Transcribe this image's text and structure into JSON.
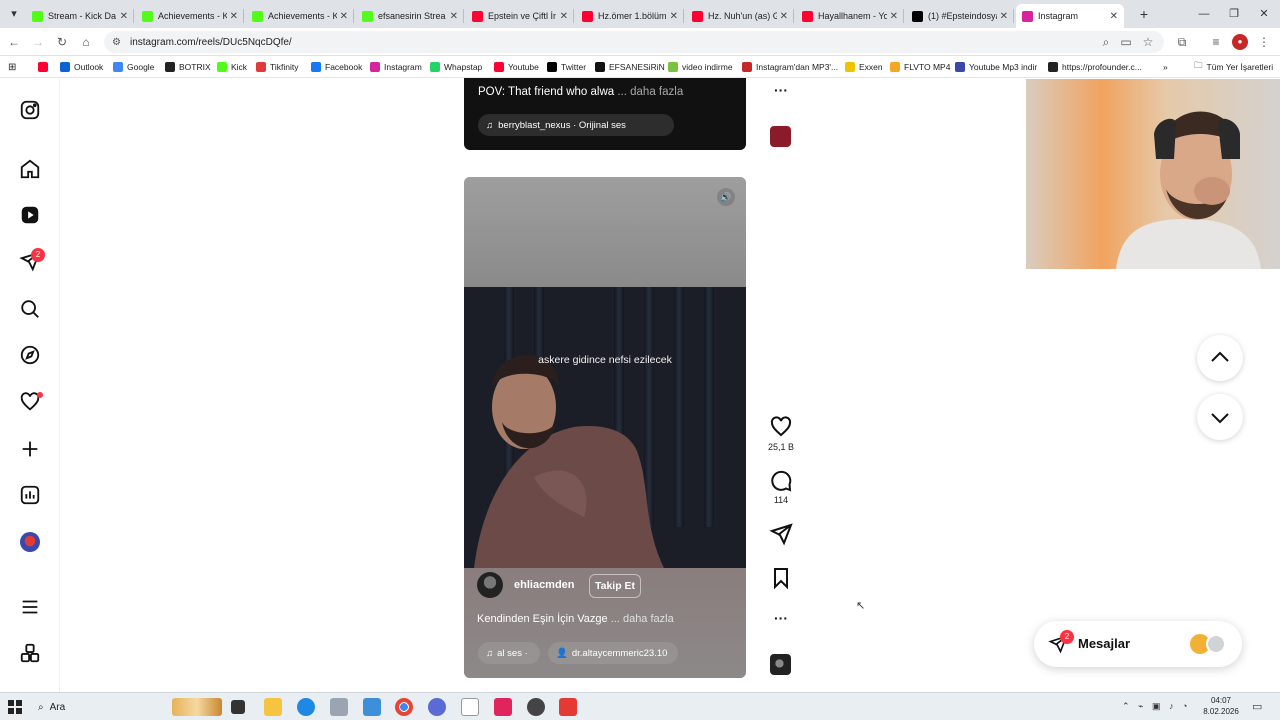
{
  "browser": {
    "tabs": [
      {
        "title": "Stream - Kick Da",
        "favicon_color": "#53fc18",
        "active": false
      },
      {
        "title": "Achievements - K",
        "favicon_color": "#53fc18",
        "active": false
      },
      {
        "title": "Achievements - K",
        "favicon_color": "#53fc18",
        "active": false
      },
      {
        "title": "efsanesirin Strea",
        "favicon_color": "#53fc18",
        "active": false
      },
      {
        "title": "Epstein ve Çiftl İr",
        "favicon_color": "#ff0033",
        "active": false
      },
      {
        "title": "Hz.ömer 1.bölüm",
        "favicon_color": "#ff0033",
        "active": false
      },
      {
        "title": "Hz. Nuh'un (as) G",
        "favicon_color": "#ff0033",
        "active": false
      },
      {
        "title": "Hayallhanem - You",
        "favicon_color": "#ff0033",
        "active": false
      },
      {
        "title": "(1) #Epsteindosya",
        "favicon_color": "#000000",
        "active": false
      },
      {
        "title": "Instagram",
        "favicon_color": "#d6249f",
        "active": true
      }
    ],
    "new_tab": "+",
    "url": "instagram.com/reels/DUc5NqcDQfe/",
    "bookmarks": [
      {
        "label": "",
        "color": "#ff0033"
      },
      {
        "label": "Outlook",
        "color": "#0a64d6"
      },
      {
        "label": "Google",
        "color": "#4285f4"
      },
      {
        "label": "BOTRIX",
        "color": "#222222"
      },
      {
        "label": "Kick",
        "color": "#53fc18"
      },
      {
        "label": "Tikfinity",
        "color": "#e03a3a"
      },
      {
        "label": "Facebook",
        "color": "#1877f2"
      },
      {
        "label": "Instagram",
        "color": "#d6249f"
      },
      {
        "label": "Whapstap",
        "color": "#25d366"
      },
      {
        "label": "Youtube",
        "color": "#ff0033"
      },
      {
        "label": "Twitter",
        "color": "#000000"
      },
      {
        "label": "EFSANESiRiN",
        "color": "#111111"
      },
      {
        "label": "video indirme",
        "color": "#7ac142"
      },
      {
        "label": "Instagram'dan MP3'...",
        "color": "#c62828"
      },
      {
        "label": "Exxen",
        "color": "#f2c200"
      },
      {
        "label": "FLVTO MP4",
        "color": "#f5a623"
      },
      {
        "label": "Youtube Mp3 indir",
        "color": "#3949ab"
      },
      {
        "label": "https://profounder.c...",
        "color": "#222222"
      }
    ],
    "more_bookmarks": "»",
    "all_bookmarks": "Tüm Yer İşaretleri"
  },
  "sidebar": {
    "notifications_badge": "2"
  },
  "prev_reel": {
    "caption": "POV: That friend who alwa",
    "more": "... daha fazla",
    "audio": "berryblast_nexus · Orijinal ses"
  },
  "reel": {
    "overlay_text": "askere gidince nefsi ezilecek",
    "username": "ehliacmden",
    "follow": "Takip Et",
    "caption": "Kendinden Eşin İçin Vazge",
    "more": "... daha fazla",
    "audio": "al ses  ·",
    "tagged_user": "dr.altaycemmeric23.10",
    "likes": "25,1 B",
    "comments": "114"
  },
  "messages": {
    "label": "Mesajlar",
    "badge": "2"
  },
  "taskbar": {
    "search": "Ara",
    "time": "04:07",
    "date": "8.02.2026"
  }
}
